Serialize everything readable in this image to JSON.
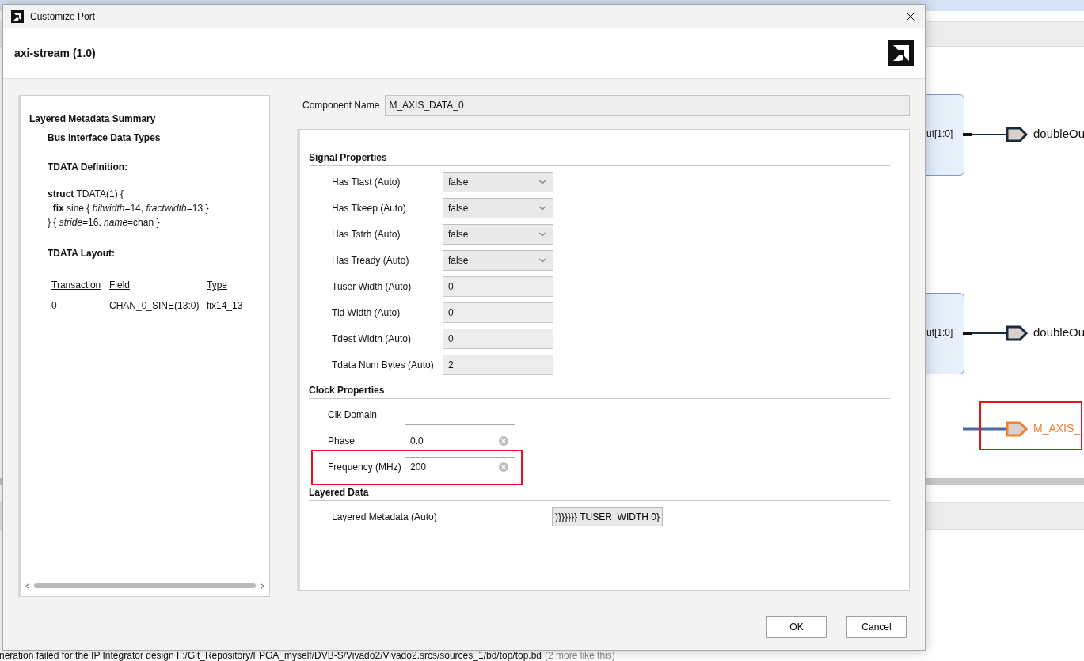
{
  "background_app": {
    "diagram": {
      "blocks": [
        {
          "port_label": "ut[1:0]",
          "output_port": "doubleOu"
        },
        {
          "port_label": "ut[1:0]",
          "output_port": "doubleOu"
        }
      ],
      "external_port": {
        "label": "M_AXIS_",
        "highlighted": true
      }
    },
    "message_bar": {
      "text": "neration failed for the IP Integrator design F:/Git_Repository/FPGA_myself/DVB-S/Vivado2/Vivado2.srcs/sources_1/bd/top/top.bd",
      "note": "(2 more like this)"
    }
  },
  "dialog": {
    "title": "Customize Port",
    "header": "axi-stream (1.0)",
    "summary": {
      "title": "Layered Metadata Summary",
      "link": "Bus Interface Data Types",
      "definition_heading": "TDATA Definition:",
      "definition_lines": [
        "**struct** TDATA(1) {",
        "  **fix** sine { *bitwidth*=14, *fractwidth*=13 }",
        "} { *stride*=16, *name*=chan }"
      ],
      "layout_heading": "TDATA Layout:",
      "table": {
        "columns": [
          "Transaction",
          "Field",
          "Type"
        ],
        "rows": [
          [
            "0",
            "CHAN_0_SINE(13:0)",
            "fix14_13"
          ]
        ]
      }
    },
    "component_name": {
      "label": "Component Name",
      "value": "M_AXIS_DATA_0"
    },
    "sections": [
      {
        "title": "Signal Properties",
        "rows": [
          {
            "label": "Has Tlast (Auto)",
            "kind": "select",
            "value": "false",
            "highlighted": false
          },
          {
            "label": "Has Tkeep (Auto)",
            "kind": "select",
            "value": "false",
            "highlighted": false
          },
          {
            "label": "Has Tstrb (Auto)",
            "kind": "select",
            "value": "false",
            "highlighted": false
          },
          {
            "label": "Has Tready (Auto)",
            "kind": "select",
            "value": "false",
            "highlighted": false
          },
          {
            "label": "Tuser Width (Auto)",
            "kind": "readonly",
            "value": "0",
            "highlighted": false
          },
          {
            "label": "Tid Width (Auto)",
            "kind": "readonly",
            "value": "0",
            "highlighted": false
          },
          {
            "label": "Tdest Width (Auto)",
            "kind": "readonly",
            "value": "0",
            "highlighted": false
          },
          {
            "label": "Tdata Num Bytes (Auto)",
            "kind": "readonly",
            "value": "2",
            "highlighted": false
          }
        ]
      },
      {
        "title": "Clock Properties",
        "rows": [
          {
            "label": "Clk Domain",
            "kind": "text",
            "highlighted": false
          },
          {
            "label": "Phase",
            "kind": "clearable",
            "value": "0.0",
            "highlighted": false
          },
          {
            "label": "Frequency (MHz)",
            "kind": "clearable",
            "value": "200",
            "highlighted": true
          }
        ]
      },
      {
        "title": "Layered Data",
        "rows": [
          {
            "label": "Layered Metadata (Auto)",
            "kind": "button",
            "value": ")}}}}}} TUSER_WIDTH 0}",
            "highlighted": false
          }
        ]
      }
    ],
    "buttons": [
      "OK",
      "Cancel"
    ]
  }
}
